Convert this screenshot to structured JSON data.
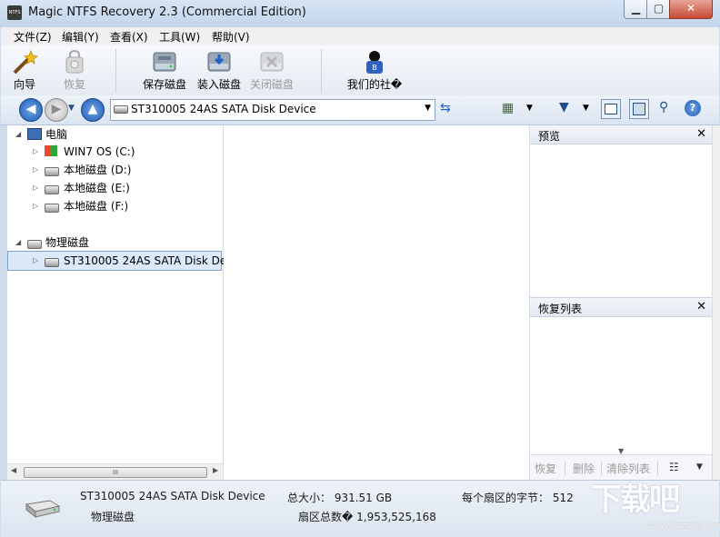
{
  "window": {
    "title": "Magic NTFS Recovery 2.3 (Commercial Edition)",
    "app_icon_text": "NTFS"
  },
  "menu": [
    "文件(Z)",
    "编辑(Y)",
    "查看(X)",
    "工具(W)",
    "帮助(V)"
  ],
  "toolbar": {
    "wizard": "向导",
    "restore": "恢复",
    "save_disk": "保存磁盘",
    "load_disk": "装入磁盘",
    "close_disk": "关闭磁盘",
    "our_community": "我们的社�"
  },
  "address": {
    "selected": "ST310005 24AS SATA Disk Device"
  },
  "tree": {
    "computer": "电脑",
    "drives": [
      "WIN7 OS (C:)",
      "本地磁盘 (D:)",
      "本地磁盘 (E:)",
      "本地磁盘 (F:)"
    ],
    "physical": "物理磁盘",
    "physical_disks": [
      "ST310005 24AS SATA Disk Device"
    ]
  },
  "scroll_thumb_text": "III",
  "preview_pane": {
    "title": "预览"
  },
  "recovery_pane": {
    "title": "恢复列表",
    "buttons": {
      "recover": "恢复",
      "delete": "删除",
      "clear": "清除列表"
    }
  },
  "status": {
    "device_name": "ST310005 24AS SATA Disk Device",
    "device_type": "物理磁盘",
    "total_size": "总大小： 931.51 GB",
    "bytes_per_sector": "每个扇区的字节： 512",
    "total_sectors": "扇区总数� 1,953,525,168"
  },
  "watermark": {
    "main": "下载吧",
    "sub": "www.xiazaiba.com"
  },
  "colors": {
    "nav_blue": "#2f6fc0",
    "window_frame": "#cfdcec",
    "selection": "#dbe9fa"
  },
  "icons": [
    "back-arrow-icon",
    "forward-arrow-icon",
    "up-arrow-icon",
    "refresh-icon",
    "view-options-icon",
    "filter-icon",
    "panel-layout-icon",
    "save-icon",
    "search-icon",
    "help-icon"
  ]
}
